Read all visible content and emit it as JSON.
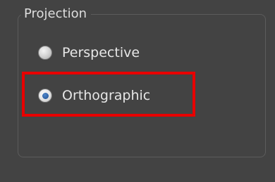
{
  "projection": {
    "group_title": "Projection",
    "options": [
      {
        "label": "Perspective",
        "checked": false
      },
      {
        "label": "Orthographic",
        "checked": true
      }
    ],
    "highlight_color": "#e80000"
  }
}
